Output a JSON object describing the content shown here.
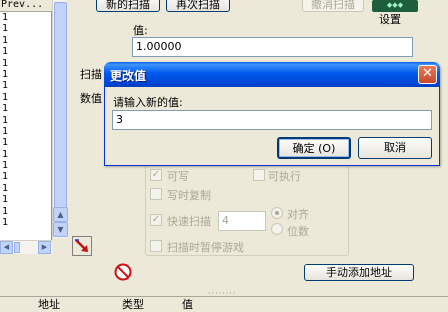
{
  "left_list": {
    "header": "Prev...",
    "rows": [
      "1",
      "1",
      "1",
      "1",
      "1",
      "1",
      "1",
      "1",
      "1",
      "1",
      "1",
      "1",
      "1",
      "1",
      "1",
      "1",
      "1",
      "1",
      "1"
    ]
  },
  "toolbar": {
    "new_scan": "新的扫描",
    "next_scan": "再次扫描",
    "undo_scan": "撤消扫描",
    "settings": "设置"
  },
  "scan": {
    "value_label": "值:",
    "value": "1.00000",
    "scan_type_label": "扫描",
    "value_type_label": "数值"
  },
  "options": {
    "writable": "可写",
    "executable": "可执行",
    "copy_on_write": "写时复制",
    "fast_scan": "快速扫描",
    "fast_scan_value": "4",
    "align": "对齐",
    "last_digits": "位数",
    "pause_game": "扫描时暂停游戏"
  },
  "add_address": "手动添加地址",
  "address_table": {
    "columns": [
      "地址",
      "类型",
      "值"
    ]
  },
  "dialog": {
    "title": "更改值",
    "prompt": "请输入新的值:",
    "value": "3",
    "ok": "确定 (O)",
    "cancel": "取消",
    "close_glyph": "✕"
  },
  "colors": {
    "titlebar": "#0054e3",
    "window_bg": "#ece9d8",
    "close_button": "#d65a3a"
  }
}
